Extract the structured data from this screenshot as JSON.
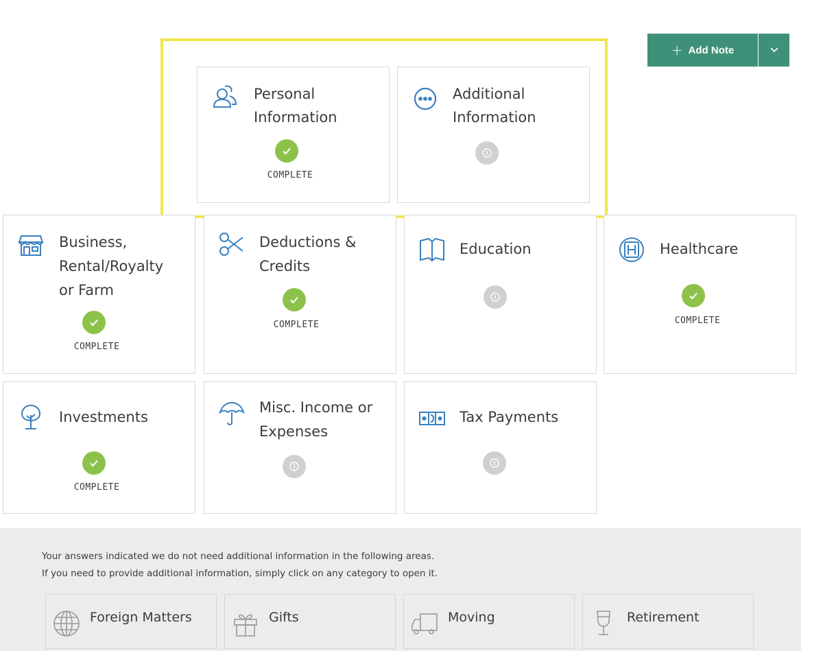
{
  "add_note": {
    "label": "Add Note",
    "plus_icon": "plus-icon",
    "dropdown_icon": "chevron-down-icon",
    "color": "#3e9178"
  },
  "highlight_color": "#f2e64e",
  "status_labels": {
    "complete": "COMPLETE"
  },
  "colors": {
    "icon_blue": "#3a7fbe",
    "complete_green": "#8cc24a",
    "pending_gray": "#d0d0d0"
  },
  "tiles": [
    {
      "id": "personal",
      "title_lines": [
        "Personal",
        "Information"
      ],
      "icon": "users-icon",
      "status": "complete"
    },
    {
      "id": "additional",
      "title_lines": [
        "Additional",
        "Information"
      ],
      "icon": "more-circle-icon",
      "status": "pending"
    },
    {
      "id": "business",
      "title_lines": [
        "Business,",
        "Rental/Royalty",
        "or Farm"
      ],
      "icon": "storefront-icon",
      "status": "complete"
    },
    {
      "id": "deductions",
      "title_lines": [
        "Deductions &",
        "Credits"
      ],
      "icon": "scissors-icon",
      "status": "complete"
    },
    {
      "id": "education",
      "title_lines": [
        "Education"
      ],
      "icon": "book-icon",
      "status": "pending"
    },
    {
      "id": "healthcare",
      "title_lines": [
        "Healthcare"
      ],
      "icon": "hospital-icon",
      "status": "complete"
    },
    {
      "id": "investments",
      "title_lines": [
        "Investments"
      ],
      "icon": "tree-icon",
      "status": "complete"
    },
    {
      "id": "misc",
      "title_lines": [
        "Misc. Income or",
        "Expenses"
      ],
      "icon": "umbrella-icon",
      "status": "pending"
    },
    {
      "id": "taxpayments",
      "title_lines": [
        "Tax Payments"
      ],
      "icon": "money-icon",
      "status": "pending"
    }
  ],
  "bottom": {
    "note_line1": "Your answers indicated we do not need additional information in the following areas.",
    "note_line2": "If you need to provide additional information, simply click on any category to open it.",
    "items": [
      {
        "label": "Foreign Matters",
        "icon": "globe-icon"
      },
      {
        "label": "Gifts",
        "icon": "gift-icon"
      },
      {
        "label": "Moving",
        "icon": "truck-icon"
      },
      {
        "label": "Retirement",
        "icon": "wine-glass-icon"
      }
    ]
  }
}
